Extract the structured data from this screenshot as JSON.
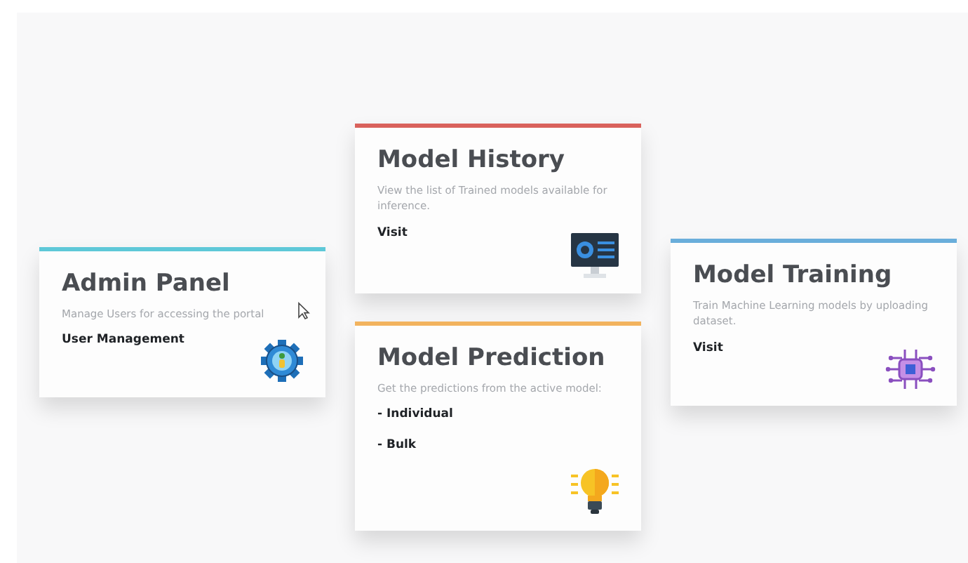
{
  "cards": [
    {
      "title": "Admin Panel",
      "color": "#5ec8d8",
      "description": "Manage Users for accessing the portal",
      "links": [
        "User Management"
      ]
    },
    {
      "title": "Model History",
      "color": "#d9625c",
      "description": "View the list of Trained models available for inference.",
      "links": [
        "Visit"
      ]
    },
    {
      "title": "Model Prediction",
      "color": "#f2b35e",
      "description": "Get the predictions from the active model:",
      "links": [
        "- Individual",
        "- Bulk"
      ]
    },
    {
      "title": "Model Training",
      "color": "#6aaedb",
      "description": "Train Machine Learning models by uploading dataset.",
      "links": [
        "Visit"
      ]
    }
  ]
}
